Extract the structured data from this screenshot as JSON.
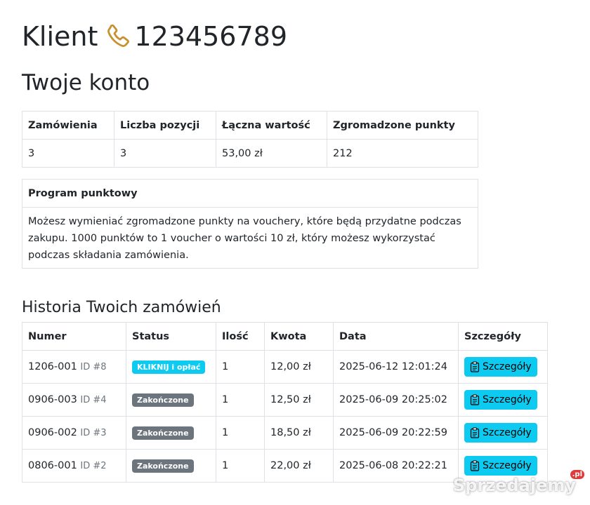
{
  "header": {
    "client_label": "Klient",
    "client_number": "123456789",
    "phone_icon": "phone-icon",
    "phone_icon_color": "#c8902e"
  },
  "account": {
    "title": "Twoje konto",
    "summary_headers": [
      "Zamówienia",
      "Liczba pozycji",
      "Łączna wartość",
      "Zgromadzone punkty"
    ],
    "summary_values": [
      "3",
      "3",
      "53,00 zł",
      "212"
    ]
  },
  "program": {
    "title": "Program punktowy",
    "text": "Możesz wymieniać zgromadzone punkty na vouchery, które będą przydatne podczas zakupu. 1000 punktów to 1 voucher o wartości 10 zł, który możesz wykorzystać podczas składania zamówienia."
  },
  "history": {
    "title": "Historia Twoich zamówień",
    "headers": [
      "Numer",
      "Status",
      "Ilość",
      "Kwota",
      "Data",
      "Szczegóły"
    ],
    "details_label": "Szczegóły",
    "rows": [
      {
        "number": "1206-001",
        "id": "ID #8",
        "status": "KLIKNIJ i opłać",
        "status_type": "info",
        "qty": "1",
        "amount": "12,00 zł",
        "date": "2025-06-12 12:01:24"
      },
      {
        "number": "0906-003",
        "id": "ID #4",
        "status": "Zakończone",
        "status_type": "secondary",
        "qty": "1",
        "amount": "12,50 zł",
        "date": "2025-06-09 20:25:02"
      },
      {
        "number": "0906-002",
        "id": "ID #3",
        "status": "Zakończone",
        "status_type": "secondary",
        "qty": "1",
        "amount": "18,50 zł",
        "date": "2025-06-09 20:22:59"
      },
      {
        "number": "0806-001",
        "id": "ID #2",
        "status": "Zakończone",
        "status_type": "secondary",
        "qty": "1",
        "amount": "22,00 zł",
        "date": "2025-06-08 20:22:21"
      }
    ]
  },
  "colors": {
    "info": "#0dcaf0",
    "secondary": "#6c757d",
    "border": "#dee2e6"
  },
  "watermark": {
    "text": "Sprzedajemy",
    "suffix": ".pl"
  }
}
